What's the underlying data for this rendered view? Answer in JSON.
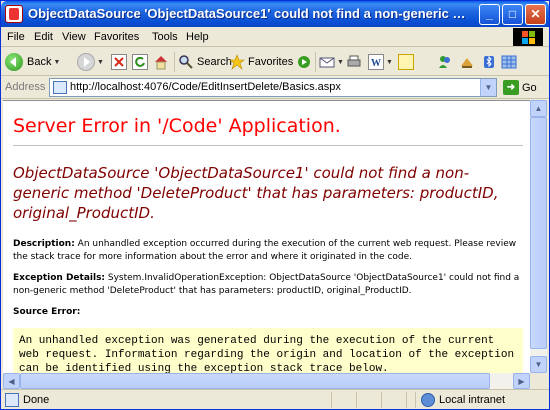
{
  "window": {
    "title": "ObjectDataSource 'ObjectDataSource1' could not find a non-generic method 'DeletePro...",
    "minimize": "_",
    "maximize": "□",
    "close": "✕"
  },
  "menu": {
    "items": [
      {
        "label": "File"
      },
      {
        "label": "Edit"
      },
      {
        "label": "View"
      },
      {
        "label": "Favorites"
      },
      {
        "label": "Tools"
      },
      {
        "label": "Help"
      }
    ]
  },
  "toolbar": {
    "back_label": "Back",
    "search_label": "Search",
    "favorites_label": "Favorites",
    "icons": [
      "back-icon",
      "forward-icon",
      "stop-icon",
      "refresh-icon",
      "home-icon",
      "search-icon",
      "favorites-icon",
      "media-icon",
      "mail-icon",
      "print-icon",
      "edit-icon",
      "discuss-icon",
      "messenger-icon",
      "research-icon",
      "bluetooth-icon"
    ]
  },
  "address": {
    "label": "Address",
    "url": "http://localhost:4076/Code/EditInsertDelete/Basics.aspx",
    "go_label": "Go"
  },
  "page": {
    "heading": "Server Error in '/Code' Application.",
    "error_title": "ObjectDataSource 'ObjectDataSource1' could not find a non-generic method 'DeleteProduct' that has parameters: productID, original_ProductID.",
    "description_label": "Description:",
    "description_text": " An unhandled exception occurred during the execution of the current web request. Please review the stack trace for more information about the error and where it originated in the code.",
    "exception_label": "Exception Details:",
    "exception_text": " System.InvalidOperationException: ObjectDataSource 'ObjectDataSource1' could not find a non-generic method 'DeleteProduct' that has parameters: productID, original_ProductID.",
    "source_error_label": "Source Error:",
    "source_error_text": "An unhandled exception was generated during the execution of the current\nweb request. Information regarding the origin and location of the exception\ncan be identified using the exception stack trace below."
  },
  "status": {
    "text": "Done",
    "zone": "Local intranet"
  },
  "colors": {
    "heading": "#ff0000",
    "error_title": "#800000",
    "source_bg": "#ffffcc",
    "titlebar": "#0a4fd4"
  }
}
